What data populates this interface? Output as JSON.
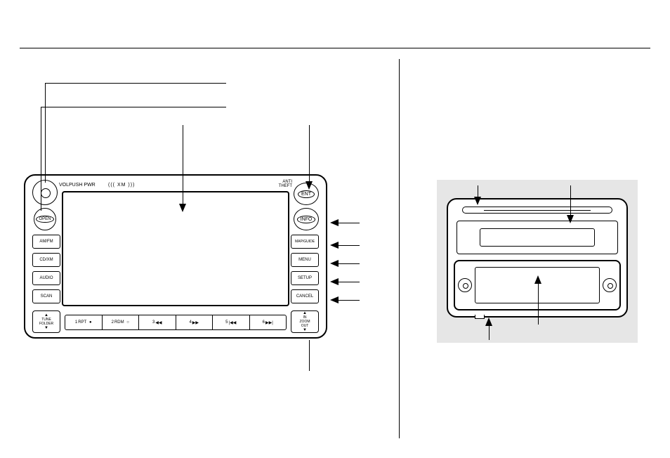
{
  "labels": {
    "vol_push_pwr": "VOLPUSH PWR",
    "xm": "((( XM )))",
    "anti_theft": "ANTI\nTHEFT",
    "ent": "ENT",
    "open": "OPEN",
    "info": "INFO"
  },
  "left_buttons": [
    "AM/FM",
    "CD/XM",
    "AUDIO",
    "SCAN"
  ],
  "right_buttons": [
    "MAP/GUIDE",
    "MENU",
    "SETUP",
    "CANCEL"
  ],
  "tune_folder": {
    "up": "▲",
    "label": "TUNE\nFOLDER",
    "down": "▼"
  },
  "zoom": {
    "up": "▲",
    "top": "IN",
    "label": "ZOOM",
    "bottom": "OUT",
    "down": "▼"
  },
  "presets": [
    {
      "num": "1",
      "label": "RPT",
      "sym": "●"
    },
    {
      "num": "2",
      "label": "RDM",
      "sym": "○"
    },
    {
      "num": "3",
      "label": "",
      "sym": "◀◀"
    },
    {
      "num": "4",
      "label": "",
      "sym": "▶▶"
    },
    {
      "num": "5",
      "label": "",
      "sym": "|◀◀"
    },
    {
      "num": "6",
      "label": "",
      "sym": "▶▶|"
    }
  ]
}
